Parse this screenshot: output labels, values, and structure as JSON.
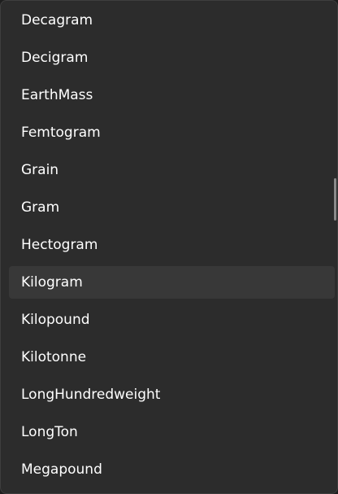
{
  "dropdown": {
    "items": [
      {
        "label": "Decagram",
        "selected": false
      },
      {
        "label": "Decigram",
        "selected": false
      },
      {
        "label": "EarthMass",
        "selected": false
      },
      {
        "label": "Femtogram",
        "selected": false
      },
      {
        "label": "Grain",
        "selected": false
      },
      {
        "label": "Gram",
        "selected": false
      },
      {
        "label": "Hectogram",
        "selected": false
      },
      {
        "label": "Kilogram",
        "selected": true
      },
      {
        "label": "Kilopound",
        "selected": false
      },
      {
        "label": "Kilotonne",
        "selected": false
      },
      {
        "label": "LongHundredweight",
        "selected": false
      },
      {
        "label": "LongTon",
        "selected": false
      },
      {
        "label": "Megapound",
        "selected": false
      }
    ]
  },
  "colors": {
    "panel_background": "#2c2c2c",
    "selected_background": "#383838",
    "text": "#ffffff",
    "scrollbar": "#8a8a8a"
  }
}
